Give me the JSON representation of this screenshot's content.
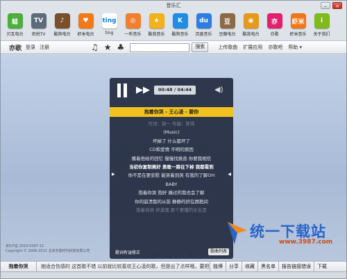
{
  "window": {
    "title": "音乐汇",
    "minimize": "–",
    "close": "×"
  },
  "apps": [
    {
      "label": "贝瓦电台",
      "icon": "frog-icon",
      "color": "#4caf3b",
      "glyph": "蛙"
    },
    {
      "label": "奇悦TV",
      "icon": "tv-icon",
      "color": "#5d6b7a",
      "glyph": "TV"
    },
    {
      "label": "酷狗电台",
      "icon": "radio-icon",
      "color": "#7a4f2c",
      "glyph": "♪"
    },
    {
      "label": "虾米电台",
      "icon": "shrimp-icon",
      "color": "#f07a1a",
      "glyph": "♥"
    },
    {
      "label": "ting",
      "icon": "ting-icon",
      "color": "#ffffff",
      "glyph": "ting"
    },
    {
      "label": "一听音乐",
      "icon": "yiting-icon",
      "color": "#f08030",
      "glyph": "◎"
    },
    {
      "label": "酷我音乐",
      "icon": "kuwo-icon",
      "color": "#f2b21a",
      "glyph": "★"
    },
    {
      "label": "酷狗音乐",
      "icon": "kugou-icon",
      "color": "#1f8de6",
      "glyph": "K"
    },
    {
      "label": "百度音乐",
      "icon": "baidu-icon",
      "color": "#2f7de0",
      "glyph": "du"
    },
    {
      "label": "豆瓣电台",
      "icon": "douban-icon",
      "color": "#8c6a46",
      "glyph": "豆"
    },
    {
      "label": "酷我电台",
      "icon": "kuwo-radio-icon",
      "color": "#e59a1c",
      "glyph": "◉"
    },
    {
      "label": "亦歌",
      "icon": "yige-icon",
      "color": "#e2206e",
      "glyph": "亦"
    },
    {
      "label": "虾米音乐",
      "icon": "xiami-icon",
      "color": "#f0761a",
      "glyph": "虾米"
    },
    {
      "label": "关于我们",
      "icon": "info-icon",
      "color": "#7fba1e",
      "glyph": "i"
    }
  ],
  "nav": {
    "brand": "亦歌",
    "login": "登录",
    "register": "注册",
    "search_placeholder": "",
    "search_button": "搜索",
    "upload": "上传歌曲",
    "extensions": "扩展应用",
    "yige_bar": "亦歌吧",
    "help": "帮助",
    "help_arrow": "▾"
  },
  "player": {
    "time": "00:48 / 04:44",
    "song": "抱着你哭 - 王心凌 - 要你",
    "lyrics": [
      {
        "text": "作词：郭一 作曲：陈伟",
        "style": "faded"
      },
      {
        "text": "(Music)",
        "style": "normal"
      },
      {
        "text": "坏掉了 什么都坏了",
        "style": "normal"
      },
      {
        "text": "CD和爱情 不明的原因",
        "style": "normal"
      },
      {
        "text": "播着他给的回忆 慢慢找换逃 你要我相信",
        "style": "normal"
      },
      {
        "text": "当初你复制美好 勇敢一路往下掉 我都看到",
        "style": "current"
      },
      {
        "text": "你不是在要安慰 能哭着到哭 有我的了解OH",
        "style": "normal"
      },
      {
        "text": "BABY",
        "style": "normal"
      },
      {
        "text": "抱着你哭 抱好 痛过的我也会了解",
        "style": "normal"
      },
      {
        "text": "你的崩溃我的从前 静静的挤在拥抱间",
        "style": "normal"
      },
      {
        "text": "抱着你哭 好道理 那个要懂的女生是",
        "style": "faded"
      }
    ],
    "lyric_fix": "歌词有误修正",
    "lyric_button": "歌曲列表"
  },
  "footer": {
    "line1": "京ICP证 2010-0397-12",
    "line2": "Copyright © 2006-2012 北京亦歌时代科技有限公司"
  },
  "watermark": {
    "text": "统一下载站",
    "url": "www.3987.com"
  },
  "pager": {
    "prev": "◀",
    "up": "▲",
    "menu": "≡",
    "next": "▶"
  },
  "bottombar": {
    "song": "抱着你哭",
    "comment": "她适合伤感的 这首歌不错 以前就比较喜欢王心凌的歌，但是出了点样哦，要把握",
    "buttons": [
      "独博",
      "分享",
      "收藏",
      "黑名单",
      "报告链接错误",
      "下载"
    ]
  }
}
